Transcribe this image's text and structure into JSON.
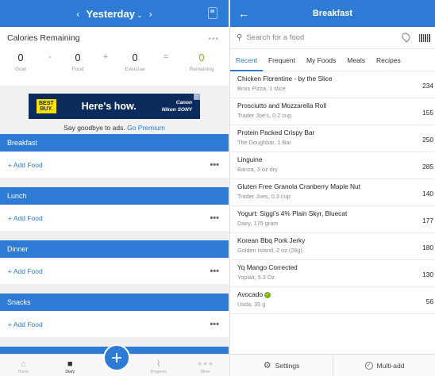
{
  "diary": {
    "header": {
      "prev": "‹",
      "title": "Yesterday",
      "chevron": "⌄",
      "next": "›",
      "diary_icon": "diary-icon"
    },
    "calories": {
      "heading": "Calories Remaining",
      "goal": {
        "value": "0",
        "label": "Goal"
      },
      "food": {
        "value": "0",
        "label": "Food"
      },
      "exercise": {
        "value": "0",
        "label": "Exercise"
      },
      "remaining": {
        "value": "0",
        "label": "Remaining"
      },
      "op_minus": "-",
      "op_plus": "+",
      "op_eq": "="
    },
    "ad": {
      "logo_line1": "BEST",
      "logo_line2": "BUY.",
      "slogan": "Here's how.",
      "brand1": "Canon",
      "brand2": "Nikon",
      "brand3": "SONY",
      "text": "Say goodbye to ads.",
      "link": "Go Premium"
    },
    "meals": [
      {
        "name": "Breakfast",
        "add": "+ Add Food",
        "more": "•••"
      },
      {
        "name": "Lunch",
        "add": "+ Add Food",
        "more": "•••"
      },
      {
        "name": "Dinner",
        "add": "+ Add Food",
        "more": "•••"
      },
      {
        "name": "Snacks",
        "add": "+ Add Food",
        "more": "•••"
      }
    ],
    "tabbar": {
      "home": "Home",
      "diary": "Diary",
      "progress": "Progress",
      "more": "More"
    }
  },
  "search_pane": {
    "title": "Breakfast",
    "back": "←",
    "search_placeholder": "Search for a food",
    "tabs": [
      "Recent",
      "Frequent",
      "My Foods",
      "Meals",
      "Recipes"
    ],
    "active_tab": "Recent",
    "foods": [
      {
        "name": "Chicken Florentine - by the Slice",
        "detail": "Brixx Pizza, 1 slice",
        "cal": "234"
      },
      {
        "name": "Prosciutto and Mozzarella Roll",
        "detail": "Trader Joe's, 0.2 cup",
        "cal": "155"
      },
      {
        "name": "Protein Packed Crispy Bar",
        "detail": "The Doughbar, 1 Bar",
        "cal": "250"
      },
      {
        "name": "Linguine",
        "detail": "Banza, 3 oz dry",
        "cal": "285"
      },
      {
        "name": "Gluten Free Granola Cranberry Maple Nut",
        "detail": "Trader Joes, 0.3 cup",
        "cal": "140"
      },
      {
        "name": "Yogurt: Siggi's 4% Plain Skyr, Bluecat",
        "detail": "Dairy, 175 gram",
        "cal": "177"
      },
      {
        "name": "Korean Bbq Pork Jerky",
        "detail": "Golden Island, 2 oz (28g)",
        "cal": "180"
      },
      {
        "name": "Yq Mango Corrected",
        "detail": "Yoplait, 5.3 Oz",
        "cal": "130"
      },
      {
        "name": "Avocado",
        "detail": "Usda, 35 g",
        "cal": "56",
        "verified": true
      }
    ],
    "bottom": {
      "settings": "Settings",
      "multi_add": "Multi-add"
    }
  },
  "colors": {
    "accent": "#2e7bd6",
    "green": "#7bb41a"
  }
}
